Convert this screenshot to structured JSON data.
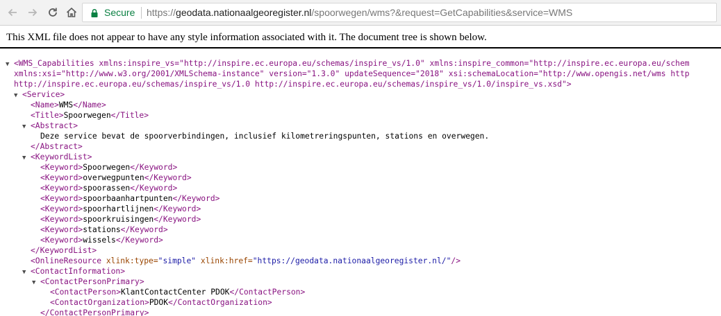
{
  "browser": {
    "secure_label": "Secure",
    "url_scheme": "https://",
    "url_host": "geodata.nationaalgeoregister.nl",
    "url_path": "/spoorwegen/wms?&request=GetCapabilities&service=WMS"
  },
  "banner": {
    "text": "This XML file does not appear to have any style information associated with it. The document tree is shown below."
  },
  "xml": {
    "root_line1": "<WMS_Capabilities xmlns:inspire_vs=\"http://inspire.ec.europa.eu/schemas/inspire_vs/1.0\" xmlns:inspire_common=\"http://inspire.ec.europa.eu/schem",
    "root_line2": "xmlns:xsi=\"http://www.w3.org/2001/XMLSchema-instance\" version=\"1.3.0\" updateSequence=\"2018\" xsi:schemaLocation=\"http://www.opengis.net/wms http",
    "root_line3": "http://inspire.ec.europa.eu/schemas/inspire_vs/1.0 http://inspire.ec.europa.eu/schemas/inspire_vs/1.0/inspire_vs.xsd\">",
    "service_open": "<Service>",
    "name_open": "<Name>",
    "name_value": "WMS",
    "name_close": "</Name>",
    "title_open": "<Title>",
    "title_value": "Spoorwegen",
    "title_close": "</Title>",
    "abstract_open": "<Abstract>",
    "abstract_text": "Deze service bevat de spoorverbindingen, inclusief kilometreringspunten, stations en overwegen.",
    "abstract_close": "</Abstract>",
    "keywordlist_open": "<KeywordList>",
    "keyword_open": "<Keyword>",
    "keyword_close": "</Keyword>",
    "keywords": [
      "Spoorwegen",
      "overwegpunten",
      "spoorassen",
      "spoorbaanhartpunten",
      "spoorhartlijnen",
      "spoorkruisingen",
      "stations",
      "wissels"
    ],
    "keywordlist_close": "</KeywordList>",
    "onlineresource_tag": "<OnlineResource",
    "onlineresource_attr1_name": "xlink:type=",
    "onlineresource_attr1_value": "\"simple\"",
    "onlineresource_attr2_name": "xlink:href=",
    "onlineresource_attr2_value": "\"https://geodata.nationaalgeoregister.nl/\"",
    "onlineresource_end": "/>",
    "contactinfo_open": "<ContactInformation>",
    "contactpersonprimary_open": "<ContactPersonPrimary>",
    "contactperson_open": "<ContactPerson>",
    "contactperson_value": "KlantContactCenter PDOK",
    "contactperson_close": "</ContactPerson>",
    "contactorg_open": "<ContactOrganization>",
    "contactorg_value": "PDOK",
    "contactorg_close": "</ContactOrganization>",
    "contactpersonprimary_close": "</ContactPersonPrimary>"
  }
}
